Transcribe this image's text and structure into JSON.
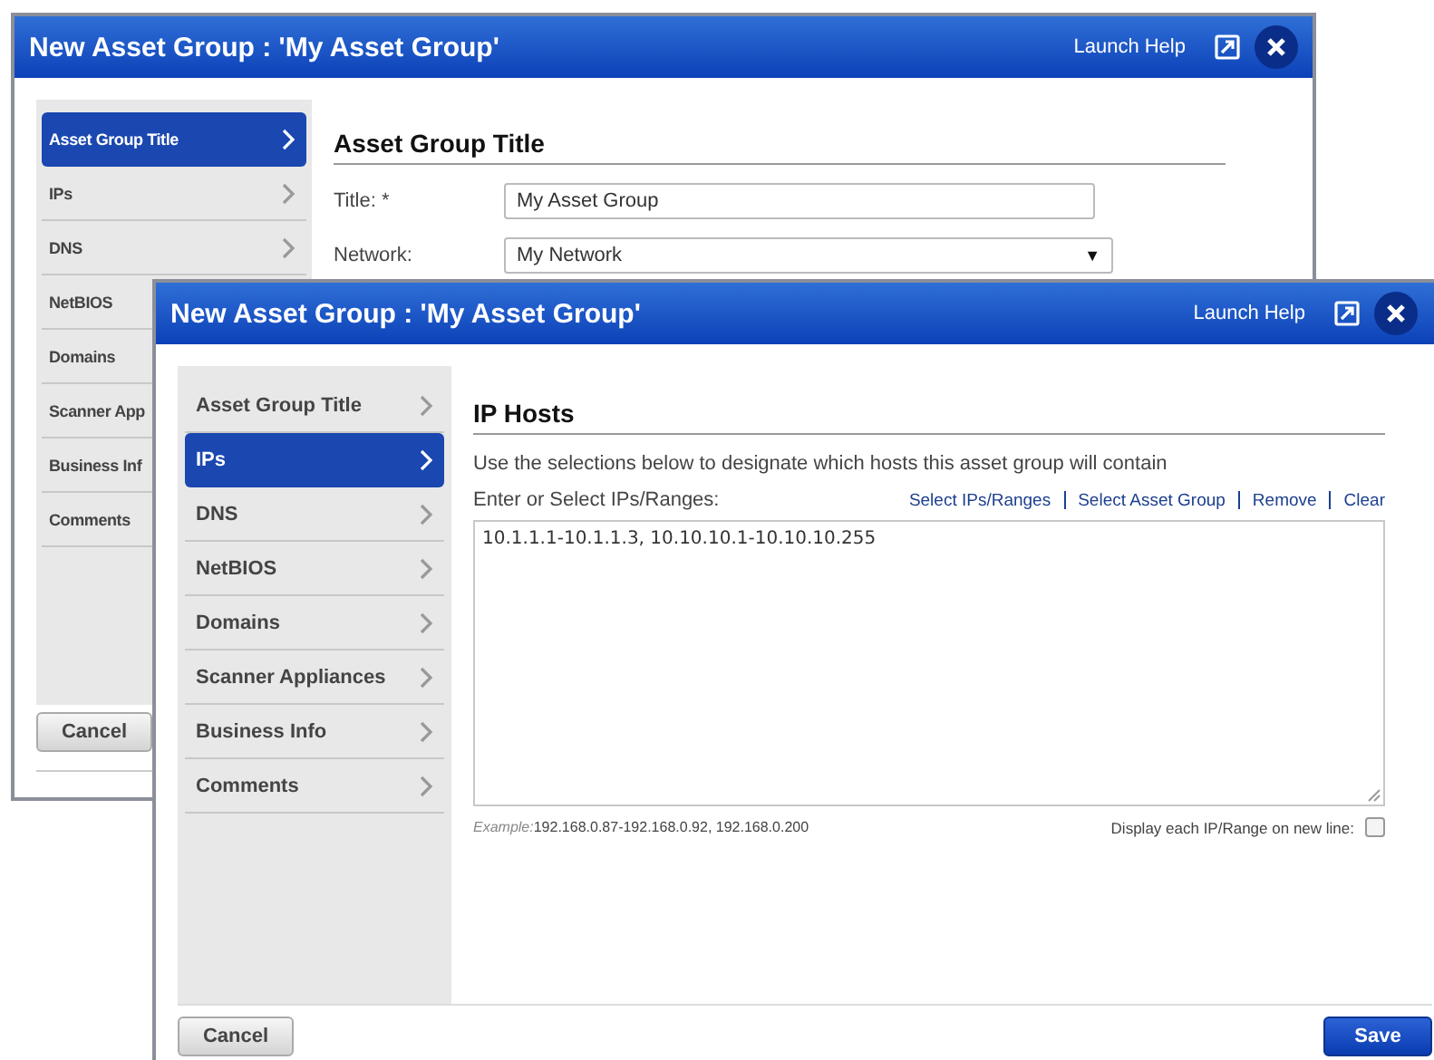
{
  "back_window": {
    "title": "New Asset Group : 'My Asset Group'",
    "help_link": "Launch Help",
    "sidebar": [
      {
        "label": "Asset Group Title",
        "selected": true
      },
      {
        "label": "IPs",
        "selected": false
      },
      {
        "label": "DNS",
        "selected": false
      },
      {
        "label": "NetBIOS",
        "selected": false
      },
      {
        "label": "Domains",
        "selected": false
      },
      {
        "label": "Scanner App",
        "selected": false
      },
      {
        "label": "Business Inf",
        "selected": false
      },
      {
        "label": "Comments",
        "selected": false
      }
    ],
    "heading": "Asset Group Title",
    "fields": [
      {
        "kind": "text",
        "label": "Title: *",
        "value": "My Asset Group"
      },
      {
        "kind": "select",
        "label": "Network:",
        "value": "My Network",
        "caret": "▼"
      }
    ],
    "cancel_button": "Cancel"
  },
  "front_window": {
    "title": "New Asset Group : 'My Asset Group'",
    "help_link": "Launch Help",
    "sidebar": [
      {
        "label": "Asset Group Title",
        "selected": false
      },
      {
        "label": "IPs",
        "selected": true
      },
      {
        "label": "DNS",
        "selected": false
      },
      {
        "label": "NetBIOS",
        "selected": false
      },
      {
        "label": "Domains",
        "selected": false
      },
      {
        "label": "Scanner Appliances",
        "selected": false
      },
      {
        "label": "Business Info",
        "selected": false
      },
      {
        "label": "Comments",
        "selected": false
      }
    ],
    "heading": "IP Hosts",
    "description": "Use the selections below to designate which hosts this asset group will contain",
    "field_label": "Enter or Select IPs/Ranges:",
    "links": [
      "Select IPs/Ranges",
      "Select Asset Group",
      "Remove",
      "Clear"
    ],
    "value": "10.1.1.1-10.1.1.3, 10.10.10.1-10.10.10.255",
    "example_label": "Example:",
    "example": "192.168.0.87-192.168.0.92, 192.168.0.200",
    "newline_option": {
      "label": "Display each IP/Range on new line:",
      "checked": false
    },
    "cancel_button": "Cancel",
    "save_button": "Save"
  }
}
